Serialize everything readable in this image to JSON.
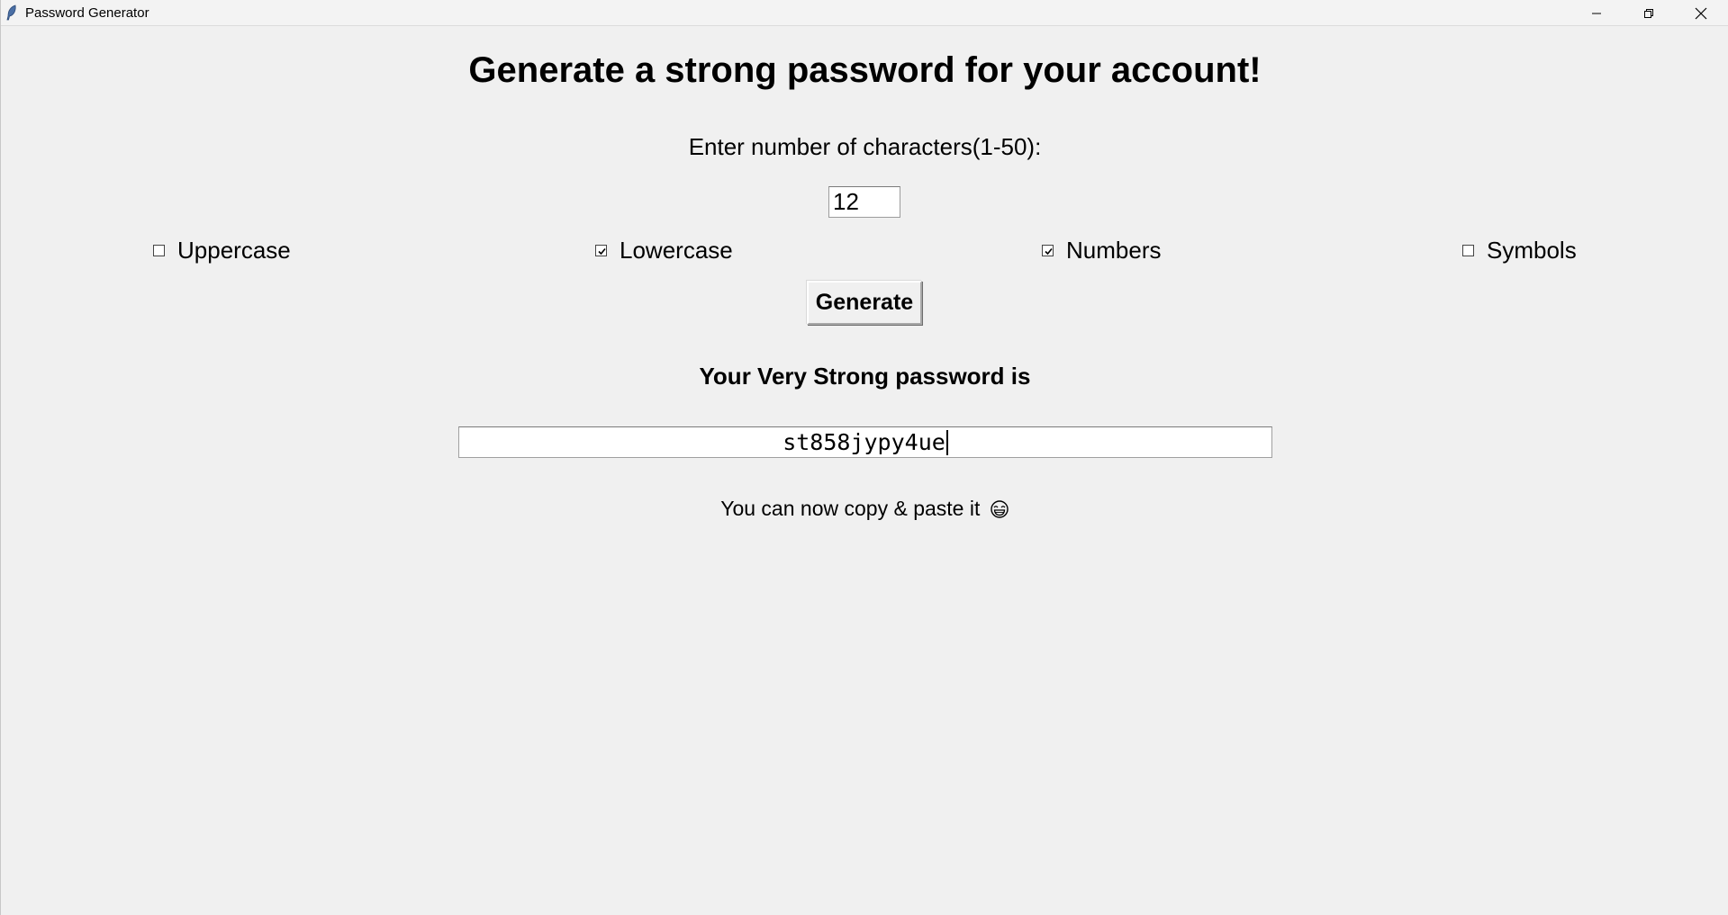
{
  "window": {
    "title": "Password Generator"
  },
  "header": {
    "title": "Generate a strong password for your account!"
  },
  "length": {
    "label": "Enter number of characters(1-50):",
    "value": "12"
  },
  "options": [
    {
      "label": "Uppercase",
      "checked": false
    },
    {
      "label": "Lowercase",
      "checked": true
    },
    {
      "label": "Numbers",
      "checked": true
    },
    {
      "label": "Symbols",
      "checked": false
    }
  ],
  "generate_button": {
    "label": "Generate"
  },
  "result": {
    "label": "Your Very Strong password is",
    "password": "st858jypy4ue"
  },
  "note": {
    "text": "You can now copy & paste it",
    "icon": "grinning-face-icon"
  }
}
